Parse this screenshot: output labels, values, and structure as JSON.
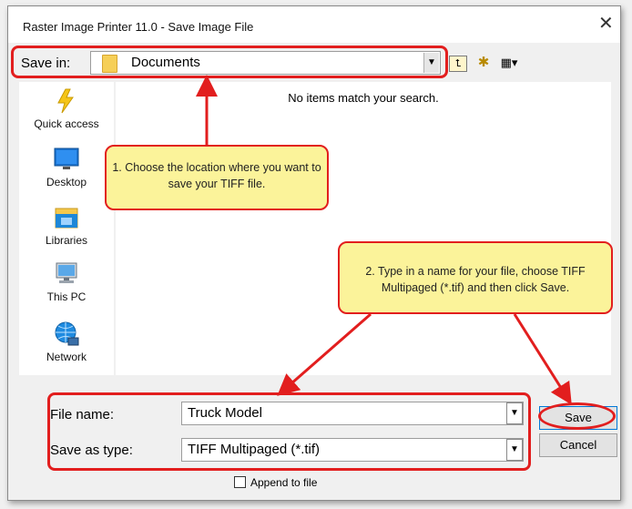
{
  "window": {
    "title": "Raster Image Printer 11.0 - Save Image File",
    "close_glyph": "✕"
  },
  "savein": {
    "label": "Save in:",
    "value": "Documents"
  },
  "toolbar": {
    "up_glyph": "⮤",
    "new_folder_glyph": "✱",
    "view_glyph": "▦▾"
  },
  "places": [
    {
      "label": "Quick access",
      "icon": "lightning-icon"
    },
    {
      "label": "Desktop",
      "icon": "desktop-icon"
    },
    {
      "label": "Libraries",
      "icon": "libraries-icon"
    },
    {
      "label": "This PC",
      "icon": "computer-icon"
    },
    {
      "label": "Network",
      "icon": "network-icon"
    }
  ],
  "filelist": {
    "empty_message": "No items match your search."
  },
  "form": {
    "filename_label": "File name:",
    "filename_value": "Truck Model",
    "savetype_label": "Save as type:",
    "savetype_value": "TIFF Multipaged (*.tif)"
  },
  "buttons": {
    "save": "Save",
    "cancel": "Cancel"
  },
  "append": {
    "label": "Append to file",
    "checked": false
  },
  "callouts": {
    "one": "1. Choose the location where you want to save your TIFF file.",
    "two": "2. Type in a name for your file, choose TIFF Multipaged (*.tif) and then click Save."
  },
  "colors": {
    "highlight": "#e21e1e",
    "callout_fill": "#fbf39a",
    "accent": "#0078d7"
  }
}
